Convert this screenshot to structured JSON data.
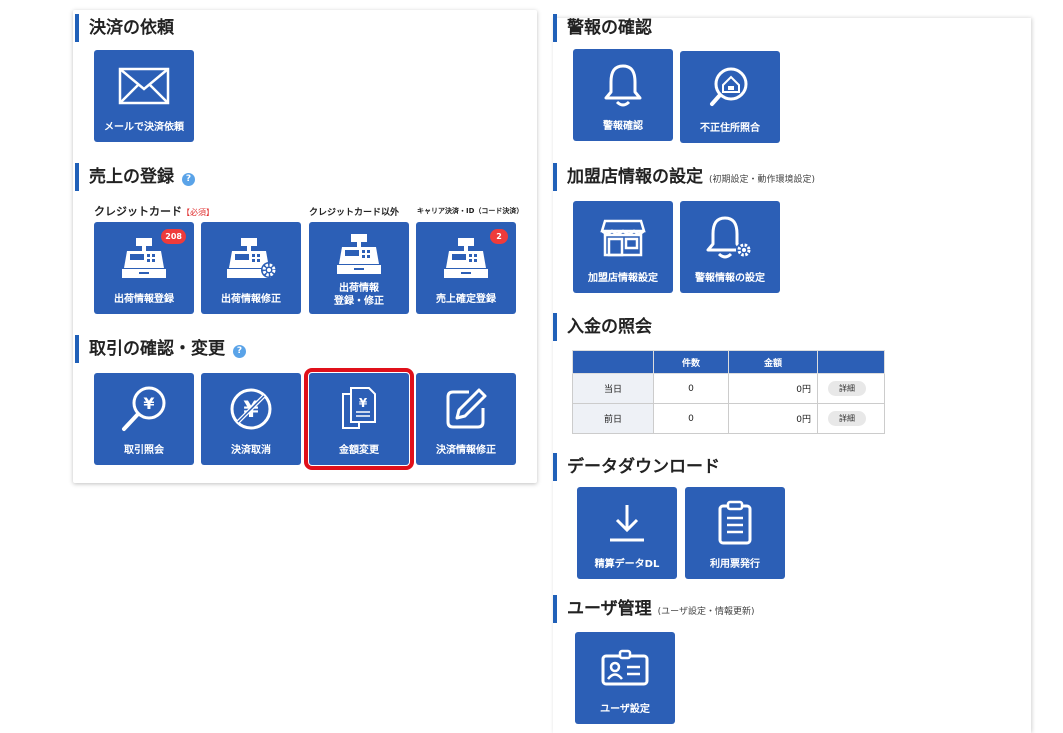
{
  "sections": {
    "payment_request": {
      "title": "決済の依頼"
    },
    "sales_registration": {
      "title": "売上の登録",
      "help": "?"
    },
    "transaction_check": {
      "title": "取引の確認・変更",
      "help": "?"
    },
    "alert_check": {
      "title": "警報の確認"
    },
    "merchant_settings": {
      "title": "加盟店情報の設定",
      "sub": "(初期設定・動作環境設定)"
    },
    "deposit": {
      "title": "入金の照会"
    },
    "data_download": {
      "title": "データダウンロード"
    },
    "user_management": {
      "title": "ユーザ管理",
      "sub": "(ユーザ設定・情報更新)"
    }
  },
  "sublabels": {
    "credit_card": "クレジットカード",
    "credit_required": "【必須】",
    "non_credit": "クレジットカード以外",
    "carrier": "キャリア決済・ID（コード決済）"
  },
  "tiles": {
    "mail_payment": "メールで決済依頼",
    "shipping_register": "出荷情報登録",
    "shipping_register_badge": "208",
    "shipping_fix": "出荷情報修正",
    "shipping_edit_line1": "出荷情報",
    "shipping_edit_line2": "登録・修正",
    "sales_confirm": "売上確定登録",
    "sales_confirm_badge": "2",
    "transaction_inquiry": "取引照会",
    "payment_cancel": "決済取消",
    "amount_change": "金額変更",
    "payment_info_fix": "決済情報修正",
    "alert_check": "警報確認",
    "address_check": "不正住所照合",
    "merchant_info": "加盟店情報設定",
    "alert_settings": "警報情報の設定",
    "settlement_dl": "精算データDL",
    "usage_slip": "利用票発行",
    "user_settings": "ユーザ設定"
  },
  "deposit_table": {
    "headers": [
      "",
      "件数",
      "金額",
      ""
    ],
    "rows": [
      {
        "label": "当日",
        "count": "0",
        "amount": "0円",
        "action": "詳細"
      },
      {
        "label": "前日",
        "count": "0",
        "amount": "0円",
        "action": "詳細"
      }
    ]
  },
  "colors": {
    "accent": "#2c5fb6",
    "selected_outline": "#e0101a",
    "badge": "#ef3b3b"
  }
}
